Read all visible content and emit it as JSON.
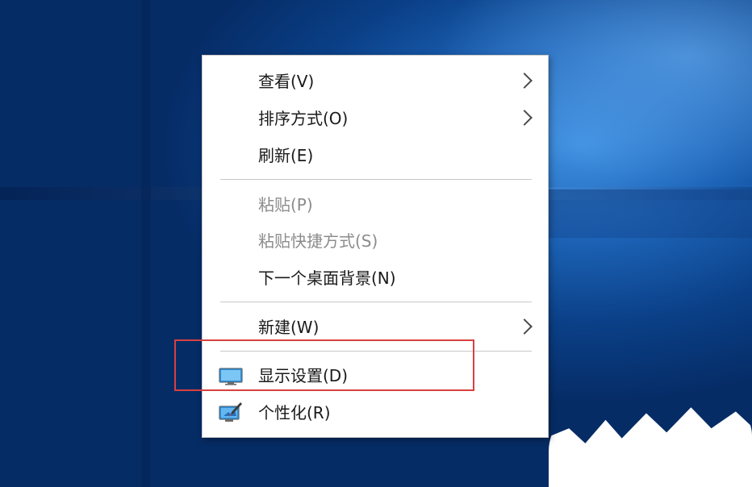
{
  "context_menu": {
    "items": [
      {
        "label": "查看(V)"
      },
      {
        "label": "排序方式(O)"
      },
      {
        "label": "刷新(E)"
      },
      {
        "label": "粘贴(P)"
      },
      {
        "label": "粘贴快捷方式(S)"
      },
      {
        "label": "下一个桌面背景(N)"
      },
      {
        "label": "新建(W)"
      },
      {
        "label": "显示设置(D)"
      },
      {
        "label": "个性化(R)"
      }
    ]
  },
  "icons": {
    "submenu": "chevron-right-icon",
    "display_settings": "monitor-icon",
    "personalize": "personalize-brush-icon"
  },
  "colors": {
    "highlight_border": "#d94040",
    "disabled_text": "#8c8c8c",
    "menu_background": "#ffffff"
  }
}
